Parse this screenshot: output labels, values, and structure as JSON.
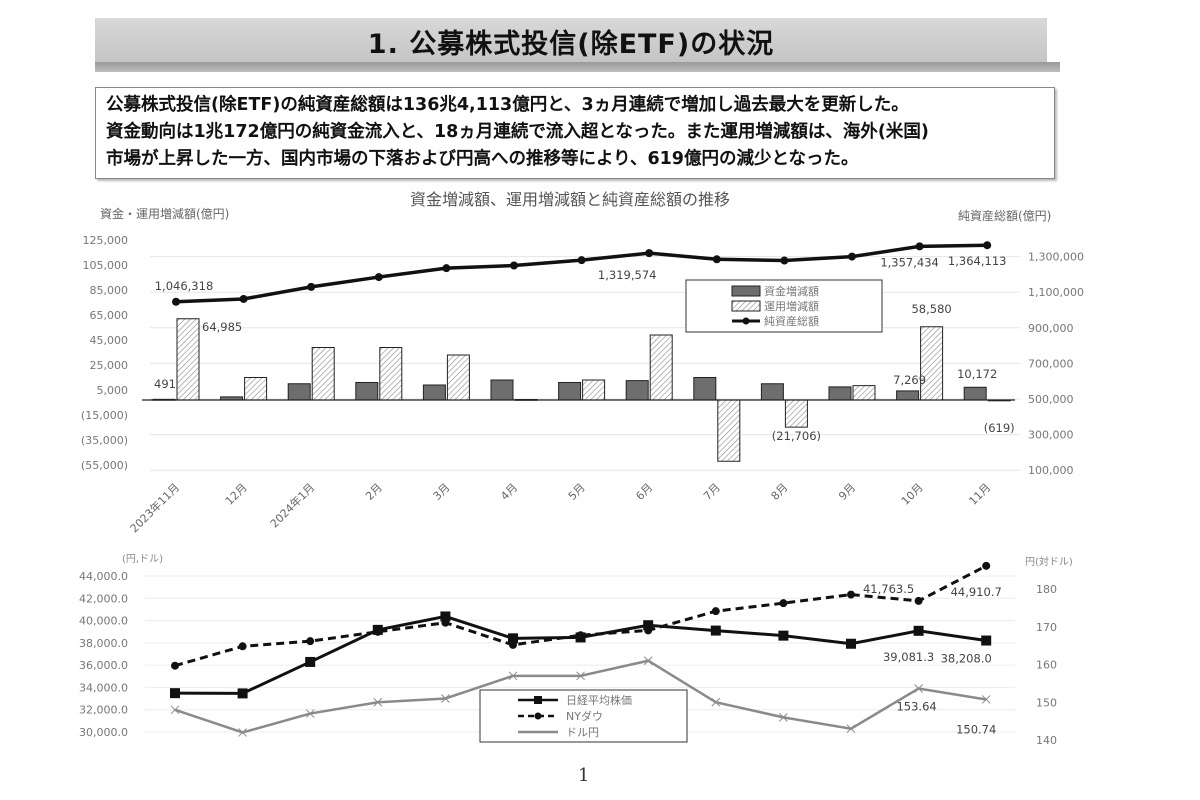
{
  "header": {
    "title": "1. 公募株式投信(除ETF)の状況"
  },
  "summary": {
    "lines": [
      "公募株式投信(除ETF)の純資産総額は136兆4,113億円と、3ヵ月連続で増加し過去最大を更新した。",
      "資金動向は1兆172億円の純資金流入と、18ヵ月連続で流入超となった。また運用増減額は、海外(米国)",
      "市場が上昇した一方、国内市場の下落および円高への推移等により、619億円の減少となった。"
    ]
  },
  "page_number": "1",
  "chart_data": [
    {
      "type": "bar",
      "title": "資金増減額、運用増減額と純資産総額の推移",
      "ylabel": "資金・運用増減額(億円)",
      "y2label": "純資産総額(億円)",
      "categories": [
        "2023年11月",
        "12月",
        "2024年1月",
        "2月",
        "3月",
        "4月",
        "5月",
        "6月",
        "7月",
        "8月",
        "9月",
        "10月",
        "11月"
      ],
      "ylim": [
        -55000,
        125000
      ],
      "yticks": [
        125000,
        105000,
        85000,
        65000,
        45000,
        25000,
        5000,
        -15000,
        -35000,
        -55000
      ],
      "ytick_labels": [
        "125,000",
        "105,000",
        "85,000",
        "65,000",
        "45,000",
        "25,000",
        "5,000",
        "(15,000)",
        "(35,000)",
        "(55,000)"
      ],
      "y2lim": [
        100000,
        1300000
      ],
      "y2ticks": [
        1300000,
        1100000,
        900000,
        700000,
        500000,
        300000,
        100000
      ],
      "y2tick_labels": [
        "1,300,000",
        "1,100,000",
        "900,000",
        "700,000",
        "500,000",
        "300,000",
        "100,000"
      ],
      "grid": true,
      "legend": "center-right",
      "series": [
        {
          "name": "資金増減額",
          "kind": "bar",
          "color": "#6e6e6e",
          "values": [
            491,
            2500,
            13000,
            14000,
            12000,
            16000,
            14000,
            15500,
            18000,
            13000,
            10500,
            7269,
            10172
          ],
          "labels": {
            "0": "491",
            "11": "7,269",
            "12": "10,172"
          }
        },
        {
          "name": "運用増減額",
          "kind": "bar-hatched",
          "color": "#ffffff",
          "values": [
            64985,
            18000,
            42000,
            42000,
            36000,
            400,
            16000,
            52000,
            -49000,
            -21706,
            11500,
            58580,
            -619
          ],
          "labels": {
            "0": "64,985",
            "9": "(21,706)",
            "11": "58,580",
            "12": "(619)"
          }
        },
        {
          "name": "純資産総額",
          "kind": "line",
          "axis": "right",
          "color": "#111111",
          "values": [
            1046318,
            1062000,
            1130000,
            1185000,
            1235000,
            1250000,
            1280000,
            1319574,
            1285000,
            1278000,
            1300000,
            1357434,
            1364113
          ],
          "labels": {
            "0": "1,046,318",
            "7": "1,319,574",
            "11": "1,357,434",
            "12": "1,364,113"
          }
        }
      ]
    },
    {
      "type": "line",
      "title": "",
      "ylabel": "(円,ドル)",
      "y2label": "円(対ドル)",
      "categories": [
        "2023年11月",
        "12月",
        "2024年1月",
        "2月",
        "3月",
        "4月",
        "5月",
        "6月",
        "7月",
        "8月",
        "9月",
        "10月",
        "11月"
      ],
      "ylim": [
        30000,
        44000
      ],
      "yticks": [
        44000,
        42000,
        40000,
        38000,
        36000,
        34000,
        32000,
        30000
      ],
      "ytick_labels": [
        "44,000.0",
        "42,000.0",
        "40,000.0",
        "38,000.0",
        "36,000.0",
        "34,000.0",
        "32,000.0",
        "30,000.0"
      ],
      "y2lim": [
        140,
        180
      ],
      "y2ticks": [
        180,
        170,
        160,
        150,
        140
      ],
      "y2tick_labels": [
        "180",
        "170",
        "160",
        "150",
        "140"
      ],
      "grid": true,
      "legend": "bottom-center",
      "series": [
        {
          "name": "日経平均株価",
          "style": "solid-square",
          "color": "#111111",
          "values": [
            33486,
            33464,
            36287,
            39166,
            40369,
            38406,
            38488,
            39583,
            39102,
            38648,
            37920,
            39081.3,
            38208.0
          ],
          "labels": {
            "11": "39,081.3",
            "12": "38,208.0"
          }
        },
        {
          "name": "NYダウ",
          "style": "dashed-circle",
          "color": "#111111",
          "values": [
            35951,
            37690,
            38150,
            38996,
            39807,
            37816,
            38686,
            39119,
            40843,
            41563,
            42330,
            41763.5,
            44910.7
          ],
          "labels": {
            "11": "41,763.5",
            "12": "44,910.7"
          }
        },
        {
          "name": "ドル円",
          "style": "gray-x",
          "axis": "right",
          "color": "#8a8a8a",
          "values": [
            148,
            142,
            147,
            150,
            151,
            157,
            157,
            161,
            150,
            146,
            143,
            153.64,
            150.74
          ],
          "labels": {
            "11": "153.64",
            "12": "150.74"
          }
        }
      ]
    }
  ]
}
